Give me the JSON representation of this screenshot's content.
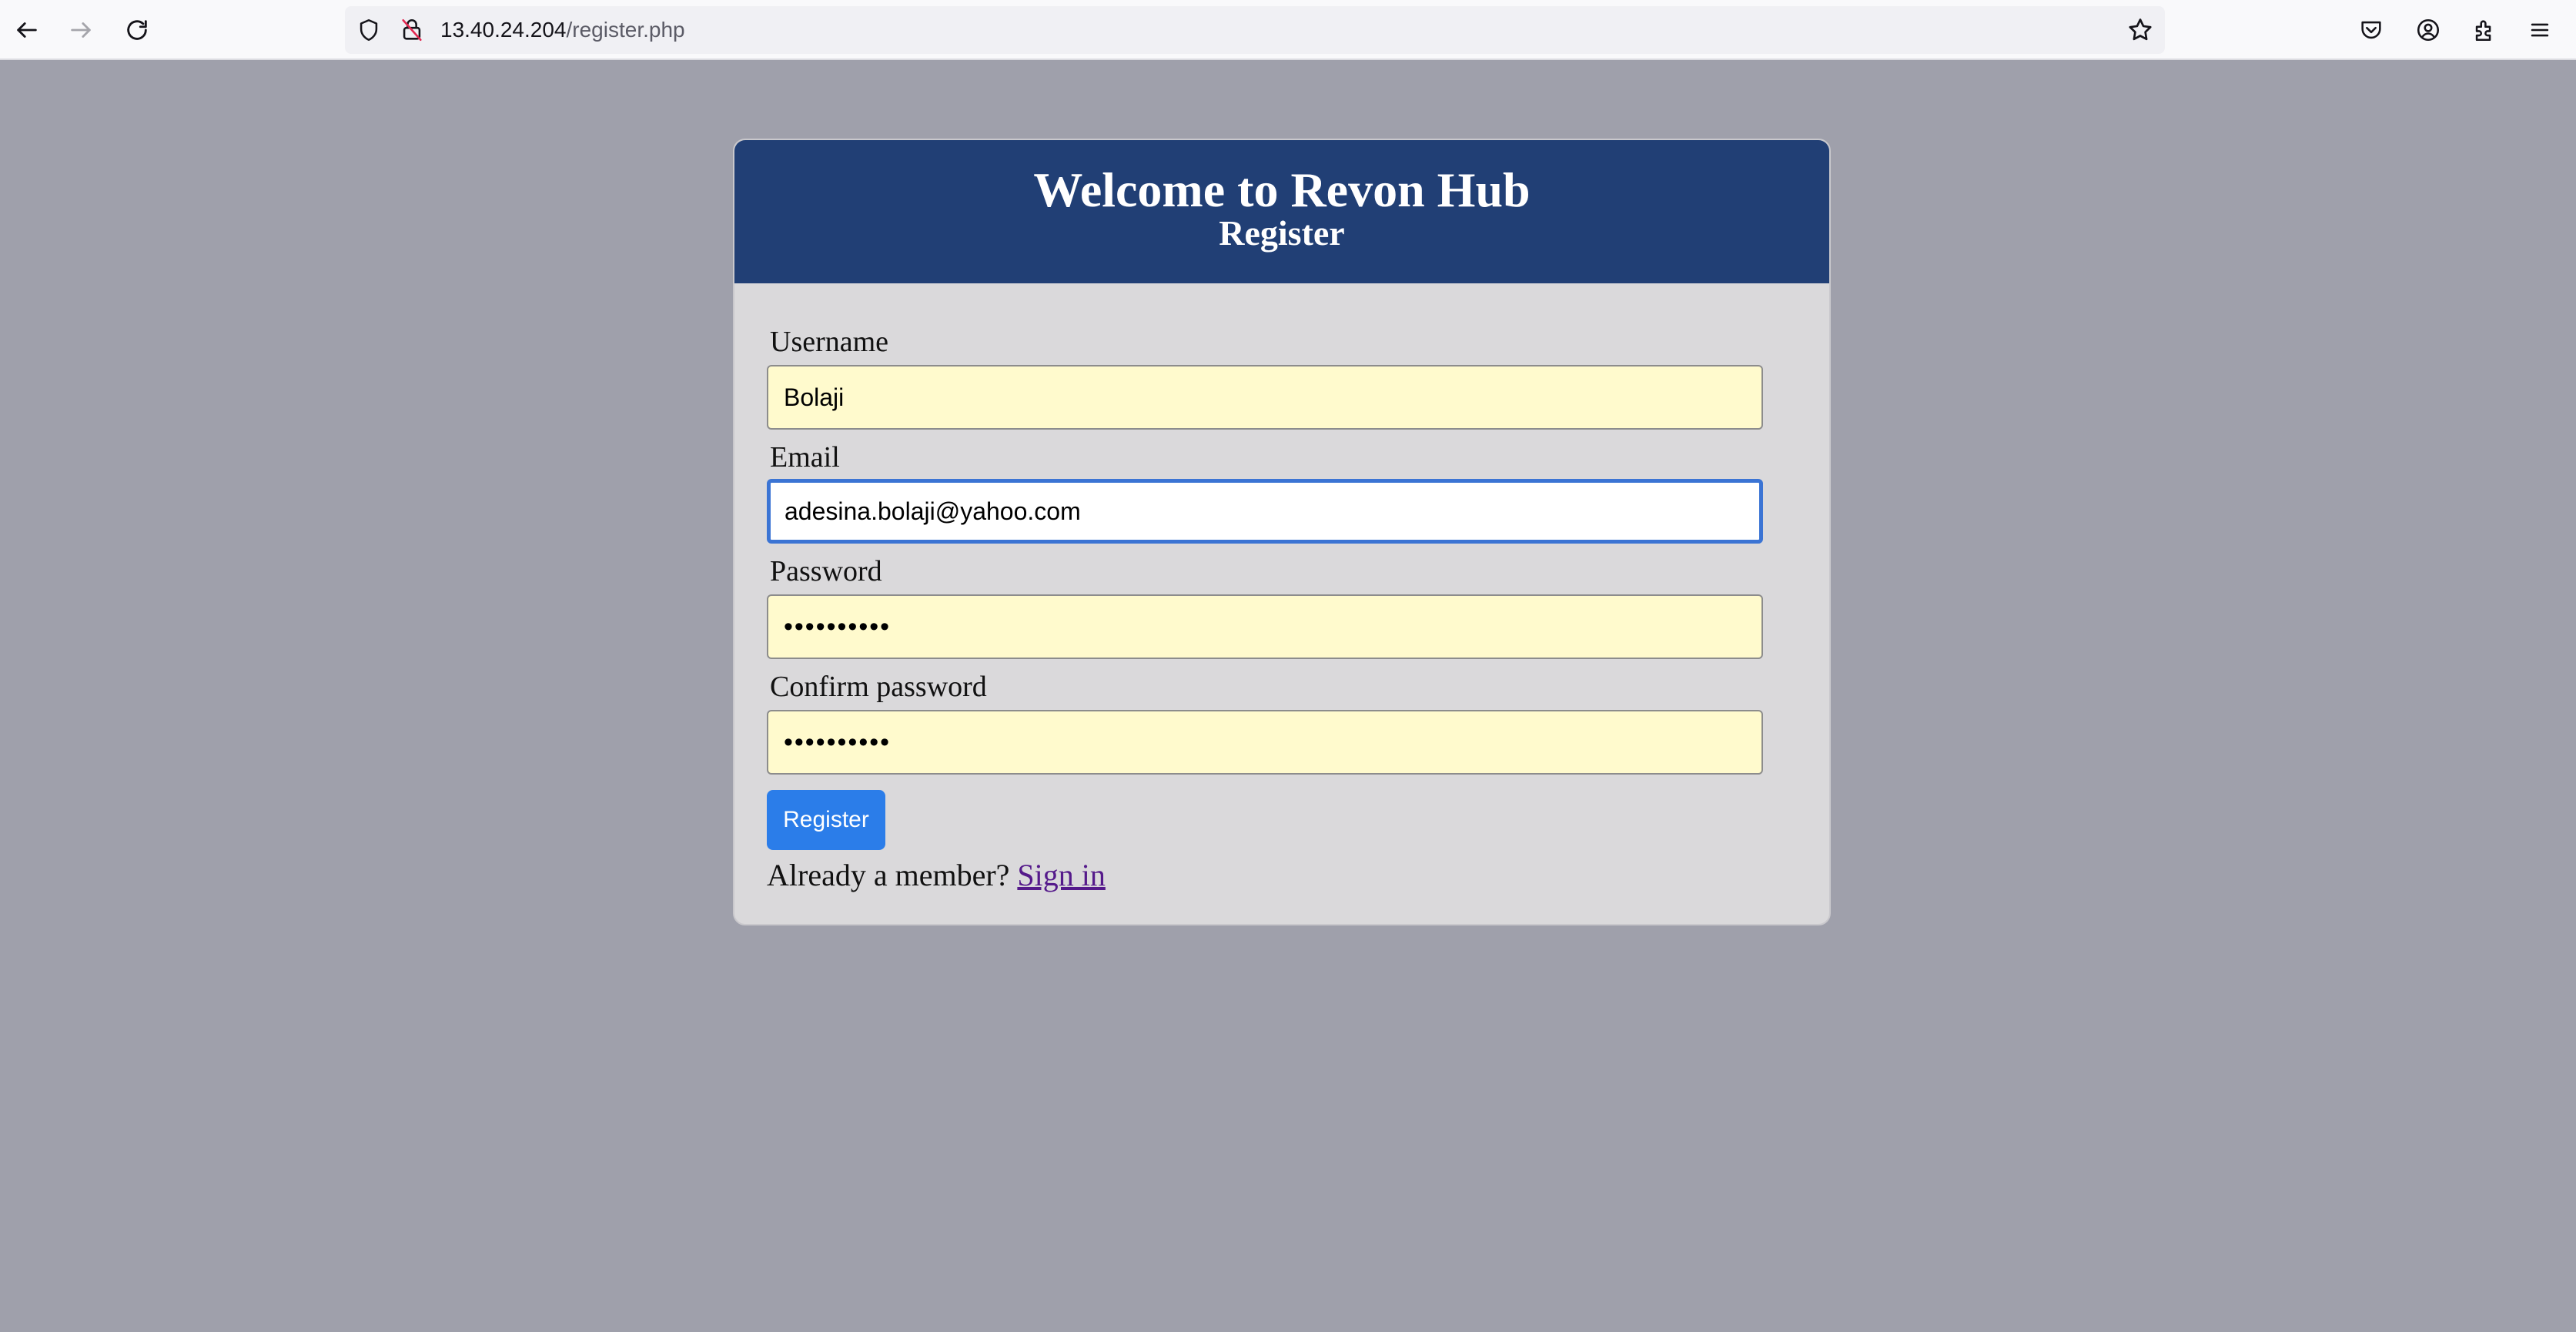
{
  "browser": {
    "url_host": "13.40.24.204",
    "url_path": "/register.php",
    "icons": [
      "back-icon",
      "forward-icon",
      "reload-icon",
      "shield-icon",
      "insecure-lock-icon",
      "bookmark-star-icon",
      "pocket-icon",
      "account-icon",
      "extensions-icon",
      "menu-icon"
    ]
  },
  "header": {
    "title": "Welcome to Revon Hub",
    "subtitle": "Register"
  },
  "form": {
    "username_label": "Username",
    "username_value": "Bolaji",
    "email_label": "Email",
    "email_value": "adesina.bolaji@yahoo.com",
    "password_label": "Password",
    "password_value": "••••••••••",
    "confirm_label": "Confirm password",
    "confirm_value": "••••••••••",
    "submit_label": "Register",
    "member_text": "Already a member?",
    "signin_label": "Sign in"
  },
  "colors": {
    "page_bg": "#9fa0ab",
    "header_bg": "#213f75",
    "card_bg": "#dad9db",
    "autofill_bg": "#fffacd",
    "focus_border": "#3b74d4",
    "button_bg": "#2b7de9",
    "link": "#551a8b"
  }
}
